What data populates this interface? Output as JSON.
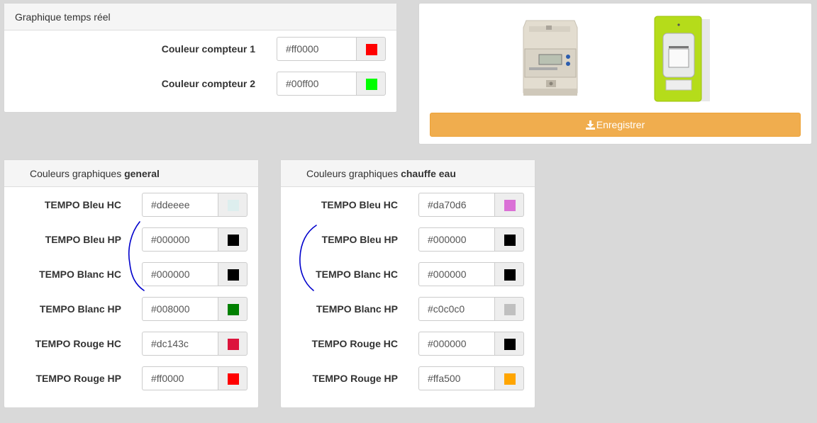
{
  "realtime": {
    "title": "Graphique temps réel",
    "rows": [
      {
        "label": "Couleur compteur 1",
        "value": "#ff0000",
        "color": "#ff0000"
      },
      {
        "label": "Couleur compteur 2",
        "value": "#00ff00",
        "color": "#00ff00"
      }
    ]
  },
  "meters": {
    "save_label": "Enregistrer",
    "save_icon": "download-icon",
    "meter1": "electric-meter-image",
    "meter2": "linky-meter-image"
  },
  "general": {
    "title_prefix": "Couleurs graphiques ",
    "title_bold": "general",
    "rows": [
      {
        "label": "TEMPO Bleu HC",
        "value": "#ddeeee",
        "color": "#ddeeee"
      },
      {
        "label": "TEMPO Bleu HP",
        "value": "#000000",
        "color": "#000000"
      },
      {
        "label": "TEMPO Blanc HC",
        "value": "#000000",
        "color": "#000000"
      },
      {
        "label": "TEMPO Blanc HP",
        "value": "#008000",
        "color": "#008000"
      },
      {
        "label": "TEMPO Rouge HC",
        "value": "#dc143c",
        "color": "#dc143c"
      },
      {
        "label": "TEMPO Rouge HP",
        "value": "#ff0000",
        "color": "#ff0000"
      }
    ]
  },
  "chauffe": {
    "title_prefix": "Couleurs graphiques ",
    "title_bold": "chauffe eau",
    "rows": [
      {
        "label": "TEMPO Bleu HC",
        "value": "#da70d6",
        "color": "#da70d6"
      },
      {
        "label": "TEMPO Bleu HP",
        "value": "#000000",
        "color": "#000000"
      },
      {
        "label": "TEMPO Blanc HC",
        "value": "#000000",
        "color": "#000000"
      },
      {
        "label": "TEMPO Blanc HP",
        "value": "#c0c0c0",
        "color": "#c0c0c0"
      },
      {
        "label": "TEMPO Rouge HC",
        "value": "#000000",
        "color": "#000000"
      },
      {
        "label": "TEMPO Rouge HP",
        "value": "#ffa500",
        "color": "#ffa500"
      }
    ]
  },
  "annotation_color": "#0000cc"
}
